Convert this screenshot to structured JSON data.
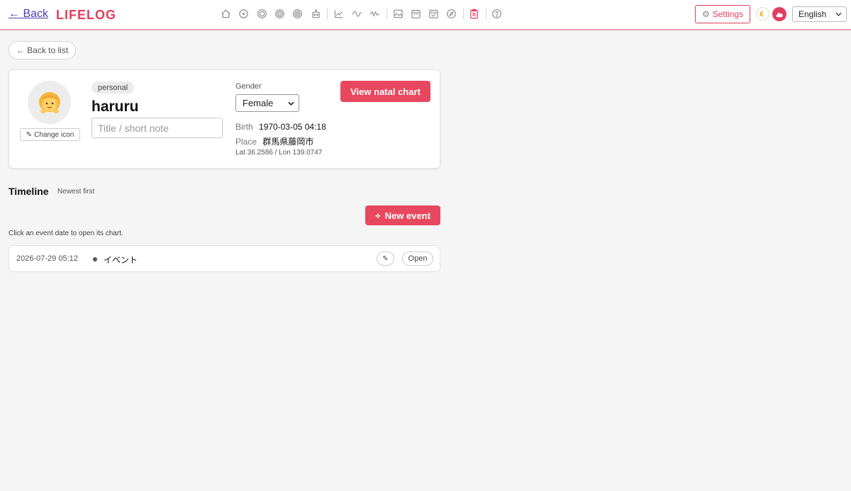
{
  "header": {
    "back_label": "← Back",
    "brand": "LIFELOG",
    "nav_icons": [
      "home-icon",
      "circle-dot-icon",
      "concentric-circles-icon",
      "target-icon",
      "filled-circle-icon",
      "robot-icon",
      "line-chart-icon",
      "wave-icon",
      "pulse-icon",
      "image-icon",
      "calendar-icon",
      "calendar-check-icon",
      "compass-icon",
      "clipboard-icon",
      "help-icon"
    ],
    "settings_label": "Settings",
    "language": "English"
  },
  "back_to_list_label": "← Back to list",
  "profile": {
    "avatar_emoji": "🧒",
    "change_icon_label": "Change icon",
    "tag": "personal",
    "name": "haruru",
    "title_placeholder": "Title / short note",
    "gender_label": "Gender",
    "gender_value": "Female",
    "birth_label": "Birth",
    "birth_value": "1970-03-05 04:18",
    "place_label": "Place",
    "place_value": "群馬県藤岡市",
    "latlon": "Lat 36.2586 / Lon 139.0747",
    "natal_button": "View natal chart"
  },
  "timeline": {
    "title": "Timeline",
    "subtitle": "Newest first",
    "new_event_label": "New event",
    "hint": "Click an event date to open its chart.",
    "events": [
      {
        "date": "2026-07-29 05:12",
        "name": "イベント",
        "open_label": "Open"
      }
    ]
  },
  "colors": {
    "accent": "#e8485f",
    "brand": "#e03e5e",
    "link": "#4a3fb0"
  }
}
